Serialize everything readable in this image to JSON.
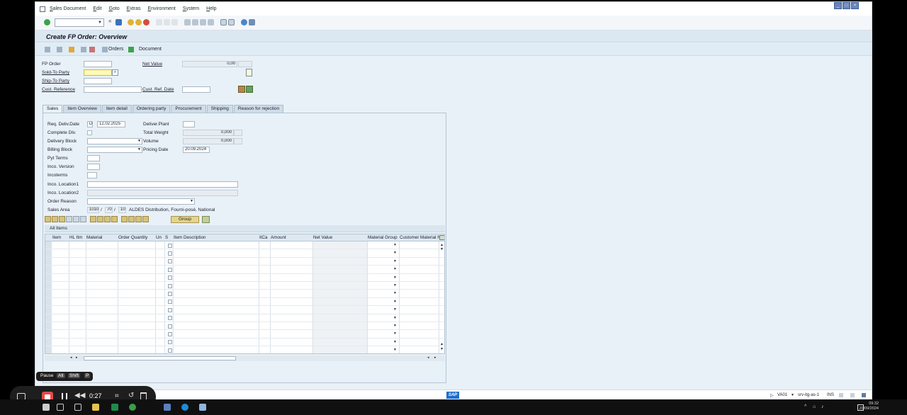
{
  "menu": [
    "Sales Document",
    "Edit",
    "Goto",
    "Extras",
    "Environment",
    "System",
    "Help"
  ],
  "screen_title": "Create FP Order: Overview",
  "app_toolbar": {
    "orders": "Orders",
    "document": "Document"
  },
  "header": {
    "fp_order_label": "FP Order",
    "sold_to_label": "Sold-To Party",
    "ship_to_label": "Ship-To Party",
    "cust_ref_label": "Cust. Reference",
    "net_value_label": "Net Value",
    "net_value": "0,00",
    "cust_ref_date_label": "Cust. Ref. Date"
  },
  "tabs": [
    "Sales",
    "Item Overview",
    "Item detail",
    "Ordering party",
    "Procurement",
    "Shipping",
    "Reason for rejection"
  ],
  "sales": {
    "req_deliv_date_label": "Req. Deliv.Date",
    "req_deliv_date_unit": "D",
    "req_deliv_date": "12.02.2025",
    "complete_dlv_label": "Complete Dlv.",
    "delivery_block_label": "Delivery Block",
    "billing_block_label": "Billing Block",
    "pyt_terms_label": "Pyt Terms",
    "inco_version_label": "Inco. Version",
    "incoterms_label": "Incoterms",
    "inco_location1_label": "Inco. Location1",
    "inco_location2_label": "Inco. Location2",
    "order_reason_label": "Order Reason",
    "sales_area_label": "Sales Area",
    "sales_org": "1010",
    "dist_channel": "70",
    "division": "10",
    "sales_area_desc": "ALDES Distribution, Fourni-posé, National",
    "deliver_plant_label": "Deliver.Plant",
    "total_weight_label": "Total Weight",
    "total_weight": "0,000",
    "volume_label": "Volume",
    "volume": "0,000",
    "pricing_date_label": "Pricing Date",
    "pricing_date": "20.09.2024",
    "group_button": "Group"
  },
  "items": {
    "section_title": "All Items",
    "columns": [
      "Item",
      "HL Itm",
      "Material",
      "Order Quantity",
      "Un",
      "S",
      "Item Description",
      "ItCa",
      "Amount",
      "Net Value",
      "Material Group",
      "Customer Material N"
    ]
  },
  "status": {
    "tcode": "VA01",
    "server": "srv-itg-as-1",
    "mode": "INS",
    "logo": "SAP"
  },
  "recorder": {
    "pause_label": "Pause",
    "keys": [
      "Alt",
      "Shift",
      "P"
    ],
    "elapsed": "0:27"
  },
  "clock": {
    "time": "09:32",
    "date": "20/09/2024"
  }
}
